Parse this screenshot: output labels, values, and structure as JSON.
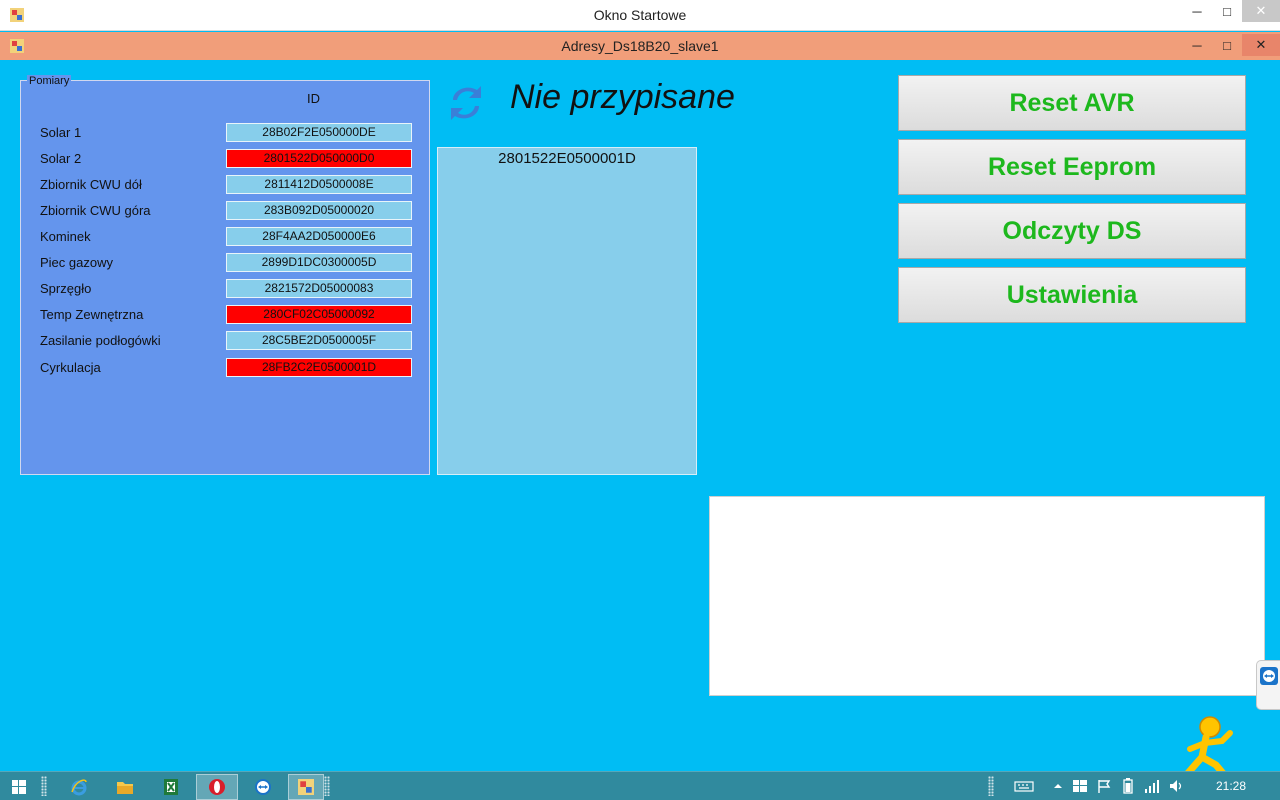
{
  "outer_window": {
    "title": "Okno Startowe"
  },
  "inner_window": {
    "title": "Adresy_Ds18B20_slave1"
  },
  "caption": {
    "minimize": "─",
    "maximize": "□",
    "close": "✕"
  },
  "groupbox": {
    "legend": "Pomiary",
    "id_header": "ID",
    "rows": [
      {
        "label": "Solar 1",
        "id": "28B02F2E050000DE",
        "bg": "#87ceeb"
      },
      {
        "label": "Solar 2",
        "id": "2801522D050000D0",
        "bg": "#ff0000"
      },
      {
        "label": "Zbiornik CWU dół",
        "id": "2811412D0500008E",
        "bg": "#87ceeb"
      },
      {
        "label": "Zbiornik CWU góra",
        "id": "283B092D05000020",
        "bg": "#87ceeb"
      },
      {
        "label": "Kominek",
        "id": "28F4AA2D050000E6",
        "bg": "#87ceeb"
      },
      {
        "label": "Piec gazowy",
        "id": "2899D1DC0300005D",
        "bg": "#87ceeb"
      },
      {
        "label": "Sprzęgło",
        "id": "2821572D05000083",
        "bg": "#87ceeb"
      },
      {
        "label": "Temp Zewnętrzna",
        "id": "280CF02C05000092",
        "bg": "#ff0000"
      },
      {
        "label": "Zasilanie podłogówki",
        "id": "28C5BE2D0500005F",
        "bg": "#87ceeb"
      },
      {
        "label": "Cyrkulacja",
        "id": "28FB2C2E0500001D",
        "bg": "#ff0000"
      }
    ]
  },
  "status": {
    "text": "Nie przypisane"
  },
  "listbox": {
    "items": [
      "2801522E0500001D"
    ]
  },
  "buttons": {
    "reset_avr": "Reset AVR",
    "reset_eeprom": "Reset Eeprom",
    "odczyty_ds": "Odczyty DS",
    "ustawienia": "Ustawienia"
  },
  "taskbar": {
    "clock": "21:28"
  },
  "colors": {
    "background": "#00bdf4",
    "groupbox": "#6495ed",
    "button_text": "#1db81d",
    "alert": "#ff0000",
    "ok": "#87ceeb"
  }
}
